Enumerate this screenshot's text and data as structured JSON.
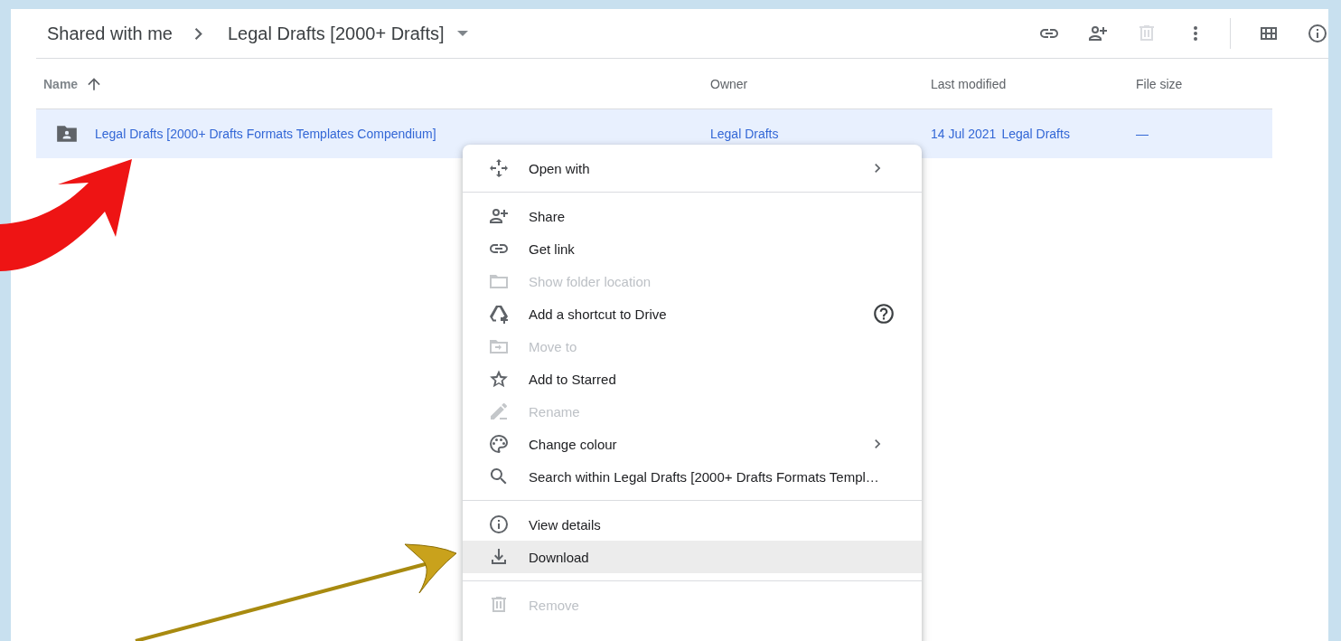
{
  "breadcrumb": [
    {
      "label": "Shared with me"
    },
    {
      "label": "Legal Drafts [2000+ Drafts]"
    }
  ],
  "table": {
    "columns": [
      {
        "label": "Name",
        "sorted": true
      },
      {
        "label": "Owner",
        "sorted": false
      },
      {
        "label": "Last modified",
        "sorted": false
      },
      {
        "label": "File size",
        "sorted": false
      }
    ],
    "rows": [
      {
        "selected": true,
        "name": "Legal Drafts [2000+ Drafts Formats Templates Compendium]",
        "owner": "Legal Drafts",
        "modified": "14 Jul 2021",
        "modified_by": "Legal Drafts",
        "size": "—"
      }
    ]
  },
  "menu": {
    "groups": [
      [
        {
          "label": "Open with",
          "disabled": false,
          "selected": false,
          "submenu": true,
          "help": false
        }
      ],
      [
        {
          "label": "Share",
          "disabled": false,
          "selected": false,
          "submenu": false,
          "help": false
        },
        {
          "label": "Get link",
          "disabled": false,
          "selected": false,
          "submenu": false,
          "help": false
        },
        {
          "label": "Show folder location",
          "disabled": true,
          "selected": false,
          "submenu": false,
          "help": false
        },
        {
          "label": "Add a shortcut to Drive",
          "disabled": false,
          "selected": false,
          "submenu": false,
          "help": true
        },
        {
          "label": "Move to",
          "disabled": true,
          "selected": false,
          "submenu": false,
          "help": false
        },
        {
          "label": "Add to Starred",
          "disabled": false,
          "selected": false,
          "submenu": false,
          "help": false
        },
        {
          "label": "Rename",
          "disabled": true,
          "selected": false,
          "submenu": false,
          "help": false
        },
        {
          "label": "Change colour",
          "disabled": false,
          "selected": false,
          "submenu": true,
          "help": false
        },
        {
          "label": "Search within Legal Drafts [2000+ Drafts Formats Templ…",
          "disabled": false,
          "selected": false,
          "submenu": false,
          "help": false
        }
      ],
      [
        {
          "label": "View details",
          "disabled": false,
          "selected": false,
          "submenu": false,
          "help": false
        },
        {
          "label": "Download",
          "disabled": false,
          "selected": true,
          "submenu": false,
          "help": false
        }
      ],
      [
        {
          "label": "Remove",
          "disabled": true,
          "selected": false,
          "submenu": false,
          "help": false
        }
      ]
    ]
  }
}
